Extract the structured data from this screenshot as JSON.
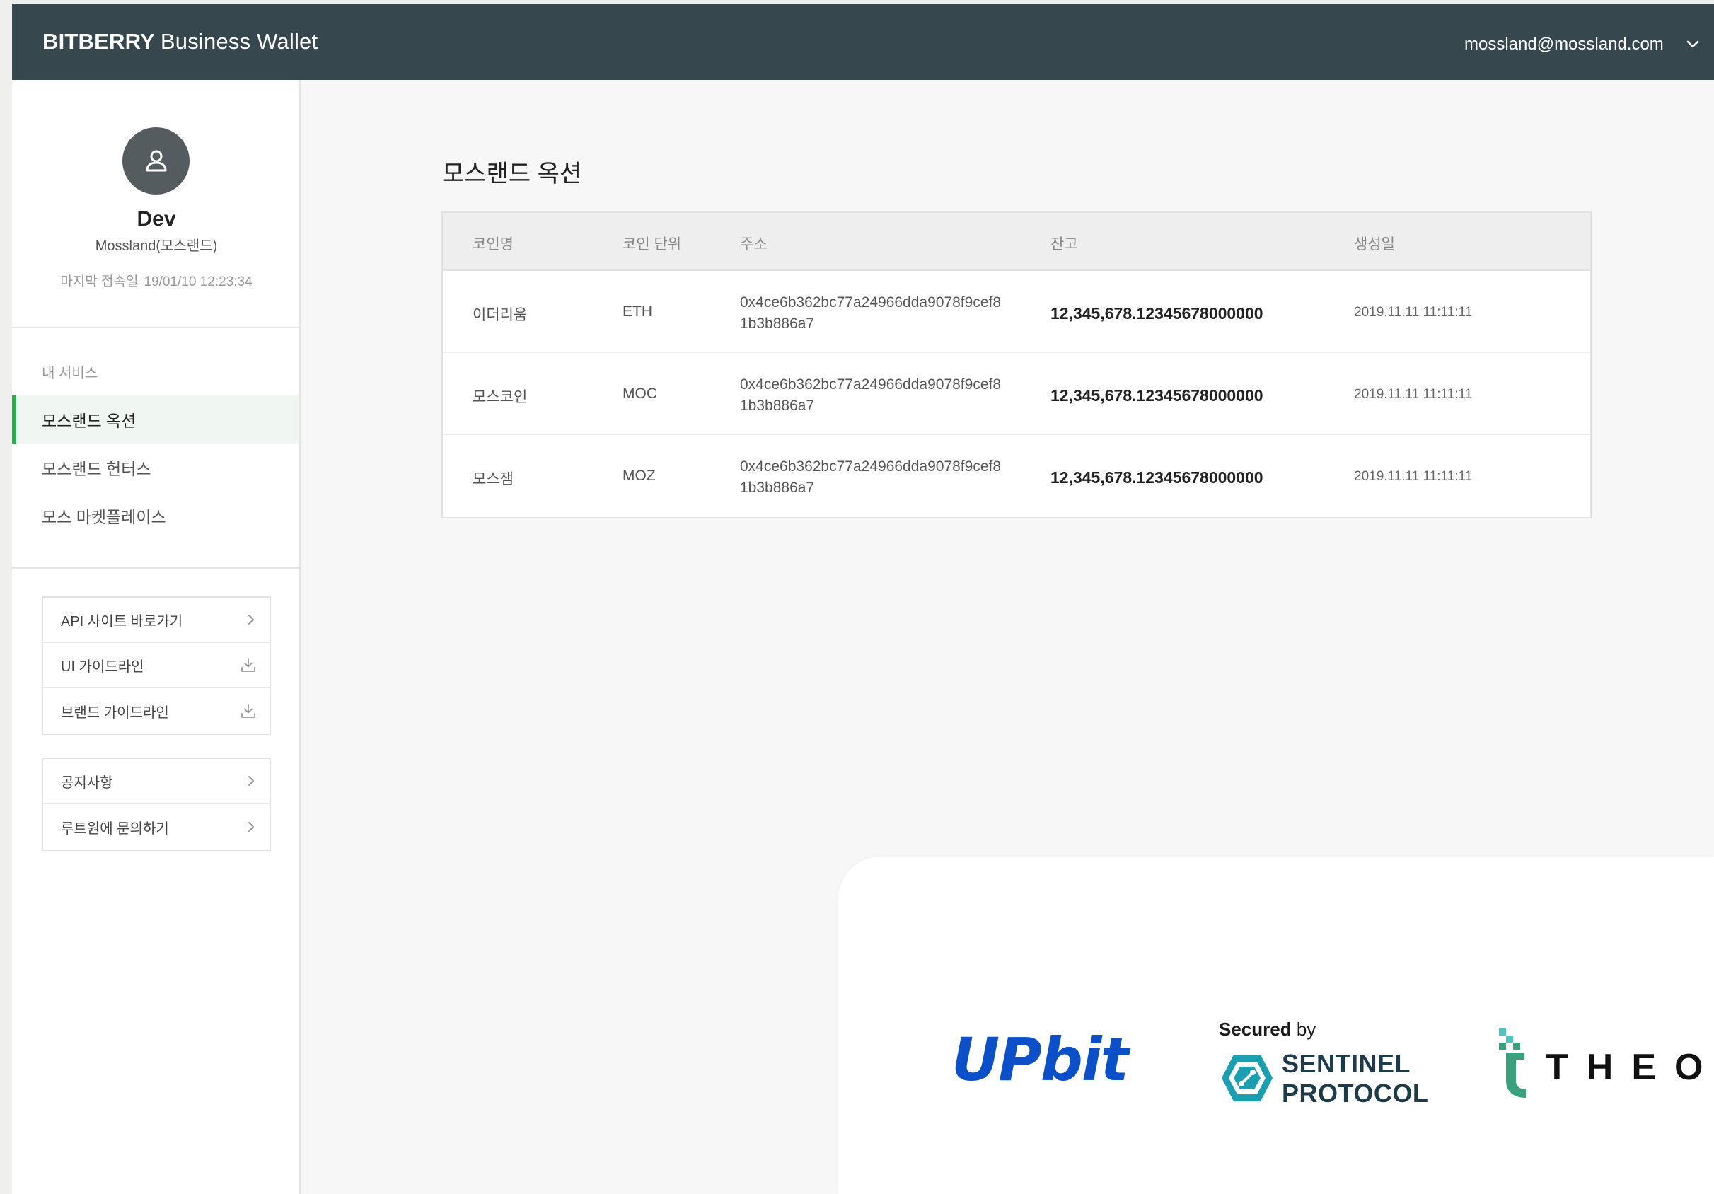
{
  "header": {
    "brand_bold": "BITBERRY",
    "brand_light": "Business Wallet",
    "user_email": "mossland@mossland.com"
  },
  "profile": {
    "name": "Dev",
    "org": "Mossland(모스랜드)",
    "last_login_label": "마지막 접속일",
    "last_login_value": "19/01/10 12:23:34"
  },
  "sidebar": {
    "section_label": "내 서비스",
    "items": [
      {
        "label": "모스랜드 옥션",
        "active": true
      },
      {
        "label": "모스랜드 헌터스",
        "active": false
      },
      {
        "label": "모스 마켓플레이스",
        "active": false
      }
    ],
    "links": [
      {
        "label": "API 사이트 바로가기",
        "icon": "chevron-right-icon"
      },
      {
        "label": "UI 가이드라인",
        "icon": "download-icon"
      },
      {
        "label": "브랜드 가이드라인",
        "icon": "download-icon"
      }
    ],
    "support_links": [
      {
        "label": "공지사항",
        "icon": "chevron-right-icon"
      },
      {
        "label": "루트원에 문의하기",
        "icon": "chevron-right-icon"
      }
    ]
  },
  "main": {
    "title": "모스랜드 옥션",
    "table": {
      "columns": [
        "코인명",
        "코인 단위",
        "주소",
        "잔고",
        "생성일"
      ],
      "rows": [
        {
          "name": "이더리움",
          "unit": "ETH",
          "address": "0x4ce6b362bc77a24966dda9078f9cef81b3b886a7",
          "balance": "12,345,678.12345678000000",
          "created": "2019.11.11 11:11:11"
        },
        {
          "name": "모스코인",
          "unit": "MOC",
          "address": "0x4ce6b362bc77a24966dda9078f9cef81b3b886a7",
          "balance": "12,345,678.12345678000000",
          "created": "2019.11.11 11:11:11"
        },
        {
          "name": "모스잼",
          "unit": "MOZ",
          "address": "0x4ce6b362bc77a24966dda9078f9cef81b3b886a7",
          "balance": "12,345,678.12345678000000",
          "created": "2019.11.11 11:11:11"
        }
      ]
    }
  },
  "partners": {
    "upbit": "UPbit",
    "secured_bold": "Secured",
    "secured_by": "by",
    "sentinel_line1": "SENTINEL",
    "sentinel_line2": "PROTOCOL",
    "theo": "THEO"
  },
  "colors": {
    "topbar": "#36474d",
    "active_accent": "#2eaa4f",
    "upbit_blue": "#0b4fc9",
    "sentinel_teal": "#1a9fb0",
    "theo_green": "#3aa17e"
  }
}
